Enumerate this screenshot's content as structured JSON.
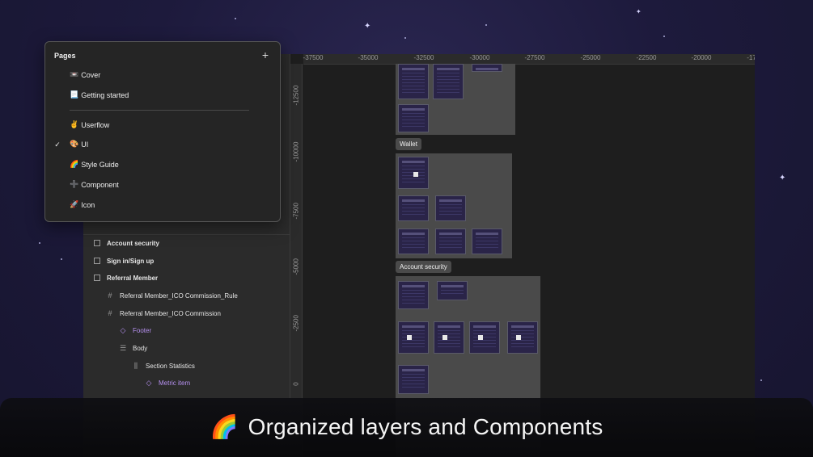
{
  "pages_panel": {
    "title": "Pages",
    "add_icon": "plus-icon",
    "items": [
      {
        "emoji": "📼",
        "label": "Cover",
        "selected": false
      },
      {
        "emoji": "📃",
        "label": "Getting started",
        "selected": false
      },
      {
        "emoji": "✌️",
        "label": "Userflow",
        "selected": false
      },
      {
        "emoji": "🎨",
        "label": "UI",
        "selected": true
      },
      {
        "emoji": "🌈",
        "label": "Style Guide",
        "selected": false
      },
      {
        "emoji": "➕",
        "label": "Component",
        "selected": false
      },
      {
        "emoji": "🚀",
        "label": "Icon",
        "selected": false
      }
    ],
    "check_mark": "✓"
  },
  "layers": [
    {
      "label": "Account security",
      "icon": "frame-icon",
      "bold": true,
      "style": "normal"
    },
    {
      "label": "Sign in/Sign up",
      "icon": "frame-icon",
      "bold": true,
      "style": "normal"
    },
    {
      "label": "Referral Member",
      "icon": "frame-icon",
      "bold": true,
      "style": "normal"
    },
    {
      "label": "Referral Member_ICO Commission_Rule",
      "icon": "hash-icon",
      "bold": false,
      "style": "normal"
    },
    {
      "label": "Referral Member_ICO Commission",
      "icon": "hash-icon",
      "bold": false,
      "style": "normal"
    },
    {
      "label": "Footer",
      "icon": "component-instance-icon",
      "bold": false,
      "style": "component"
    },
    {
      "label": "Body",
      "icon": "auto-layout-vertical-icon",
      "bold": false,
      "style": "normal"
    },
    {
      "label": "Section Statistics",
      "icon": "auto-layout-horizontal-icon",
      "bold": false,
      "style": "normal"
    },
    {
      "label": "Metric item",
      "icon": "component-instance-icon",
      "bold": false,
      "style": "component"
    }
  ],
  "ruler": {
    "x_labels": [
      "-37500",
      "-35000",
      "-32500",
      "-30000",
      "-27500",
      "-25000",
      "-22500",
      "-20000",
      "-17"
    ],
    "y_labels": [
      "-12500",
      "-10000",
      "-7500",
      "-5000",
      "-2500",
      "0"
    ]
  },
  "canvas_labels": {
    "wallet": "Wallet",
    "account_security": "Account security"
  },
  "caption": {
    "emoji": "🌈",
    "text": "Organized layers and Components"
  },
  "colors": {
    "background": "#1d1a3c",
    "component_purple": "#b690f0",
    "panel": "#252525"
  }
}
